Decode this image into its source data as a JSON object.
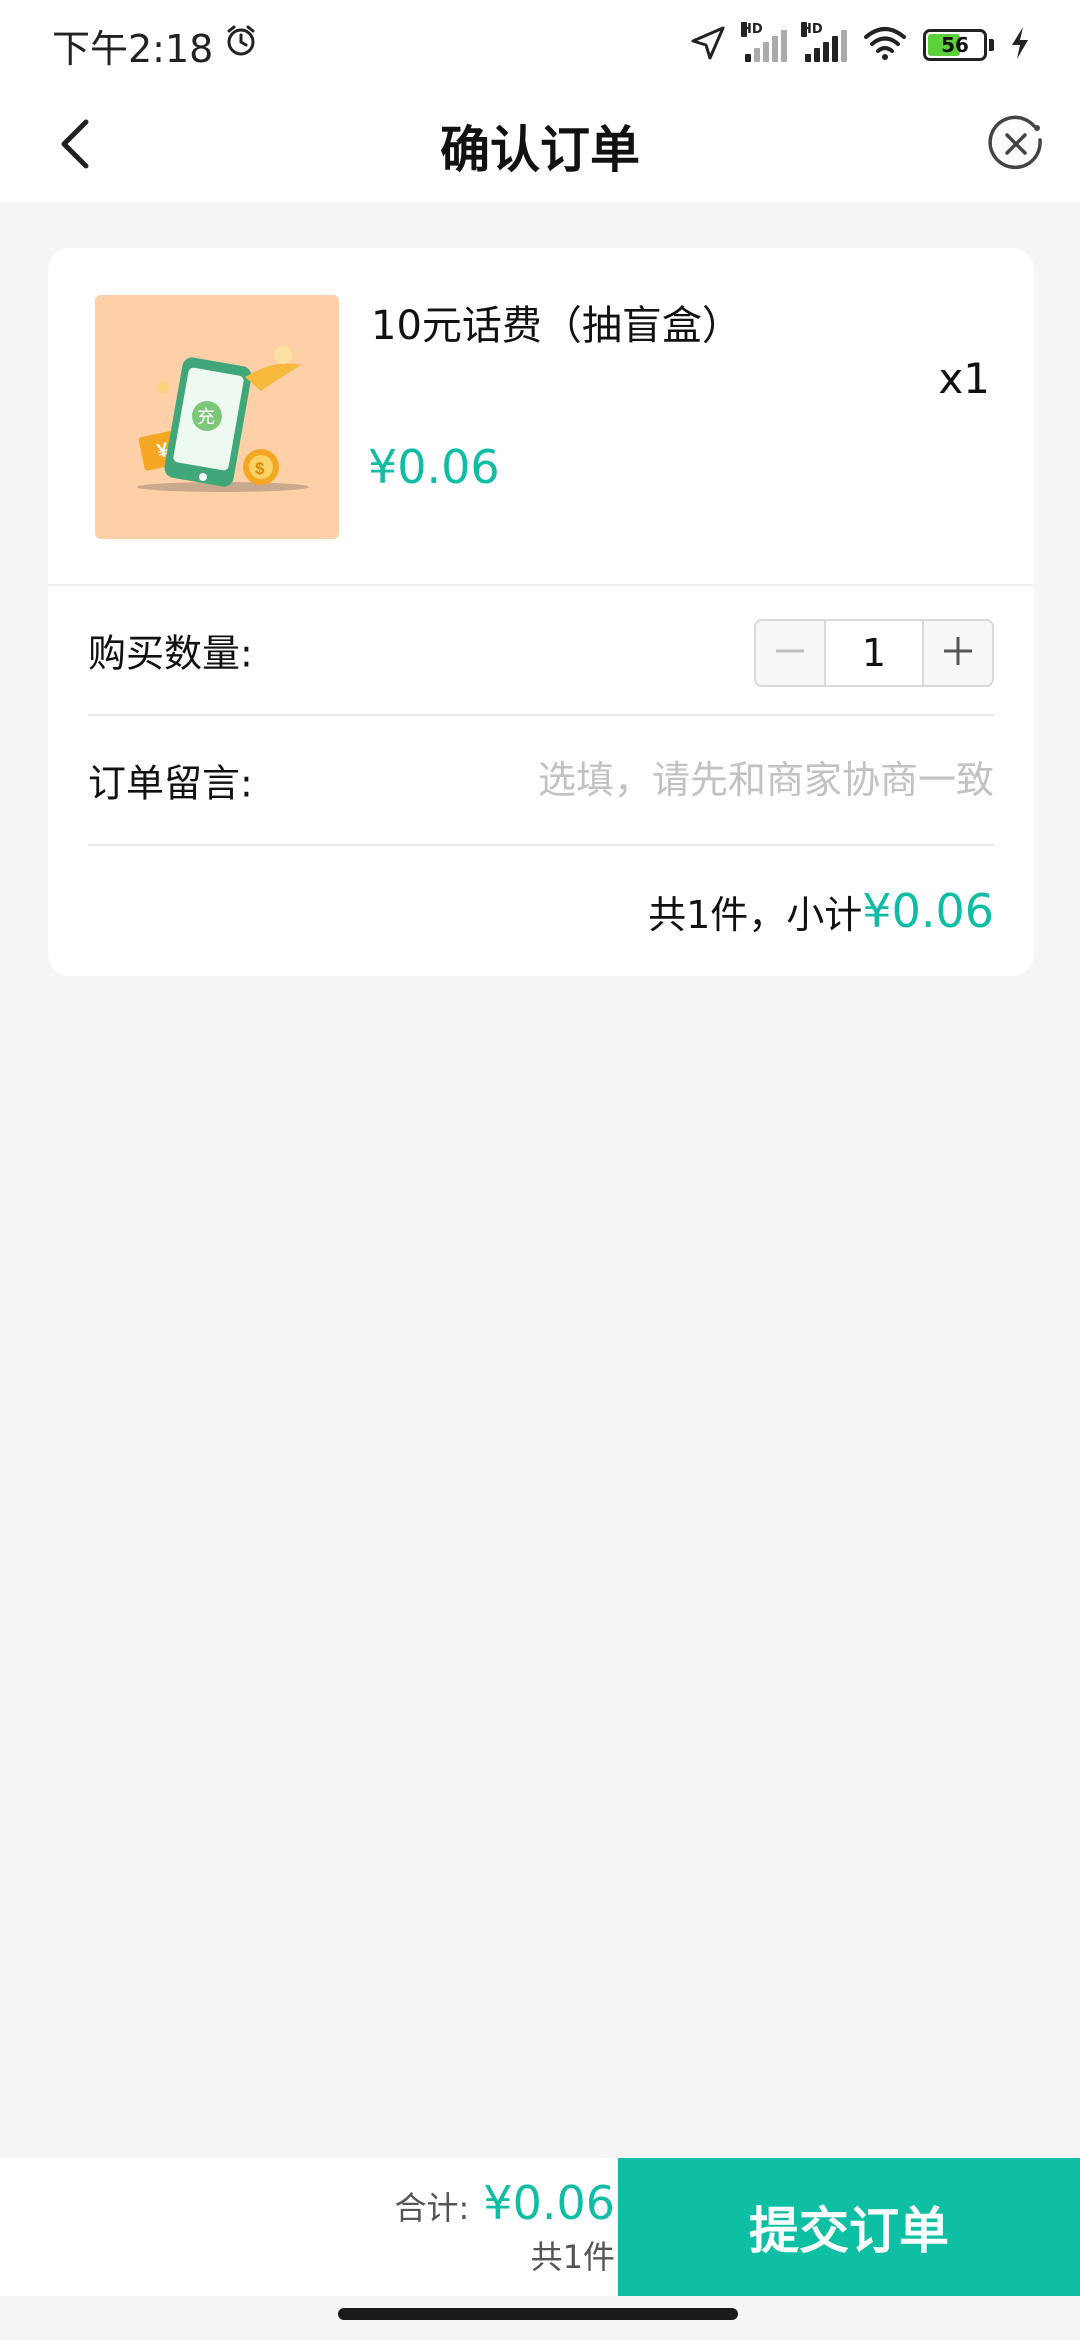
{
  "status_bar": {
    "time": "下午2:18",
    "alarm_icon": "alarm-clock-icon",
    "location_icon": "location-arrow-icon",
    "signal1_label": "HD",
    "signal2_label": "HD",
    "wifi_icon": "wifi-icon",
    "battery_level": "56",
    "charging_icon": "charging-bolt-icon"
  },
  "nav": {
    "title": "确认订单",
    "back_icon": "chevron-left-icon",
    "close_icon": "close-circle-icon"
  },
  "product": {
    "name": "10元话费（抽盲盒）",
    "price": "¥0.06",
    "quantity": "x1",
    "thumbnail_icon": "phone-recharge-illustration",
    "thumbnail_text": "充"
  },
  "quantity_row": {
    "label": "购买数量:",
    "value": "1",
    "minus_icon": "minus-icon",
    "plus_icon": "plus-icon"
  },
  "note_row": {
    "label": "订单留言:",
    "placeholder": "选填，请先和商家协商一致",
    "value": ""
  },
  "subtotal": {
    "text": "共1件，小计",
    "price": "¥0.06"
  },
  "bottom_bar": {
    "total_label": "合计:",
    "total_price": "¥0.06",
    "total_count": "共1件",
    "submit_label": "提交订单"
  },
  "colors": {
    "accent": "#0fbca4",
    "button": "#0fbfa3",
    "background": "#f5f5f5"
  }
}
